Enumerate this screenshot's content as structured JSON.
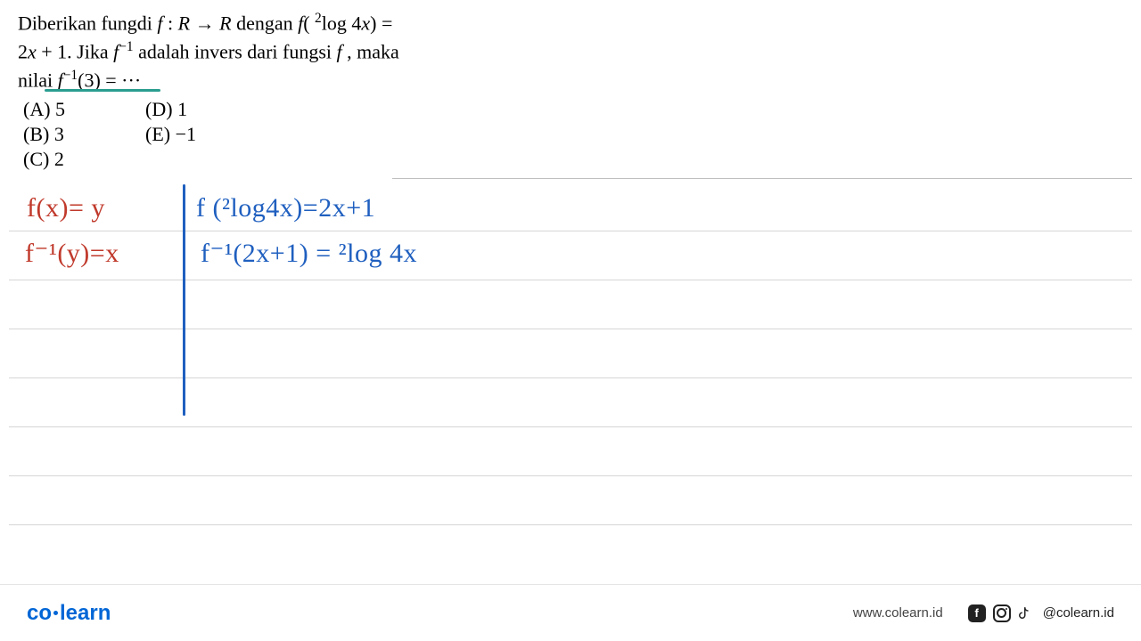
{
  "question": {
    "line1_html": "Diberikan fungdi <span class='ital'>f</span> : <span class='ital'>R</span> → <span class='ital'>R</span> dengan <span class='ital'>f</span>( <span class='sup'>2</span>log 4<span class='ital'>x</span>) =",
    "line2_html": "2<span class='ital'>x</span> + 1. Jika <span class='ital'>f</span><span class='sup'>−1</span> adalah invers dari fungsi <span class='ital'>f</span> , maka",
    "line3_html": "nilai <span class='ital'>f</span><span class='sup'>−1</span>(3) = ···"
  },
  "options": {
    "a": "(A) 5",
    "b": "(B) 3",
    "c": "(C) 2",
    "d": "(D) 1",
    "e": "(E) −1"
  },
  "handwriting": {
    "hw1": "f(x)= y",
    "hw2": "f⁻¹(y)=x",
    "hw3": "f (²log4x)=2x+1",
    "hw4": "f⁻¹(2x+1) = ²log 4x"
  },
  "footer": {
    "logo_part1": "co",
    "logo_part2": "learn",
    "url": "www.colearn.id",
    "handle": "@colearn.id"
  },
  "colors": {
    "teal": "#2a9d8f",
    "red": "#c0392b",
    "blue": "#1f5fbf",
    "brand": "#0066d6"
  }
}
